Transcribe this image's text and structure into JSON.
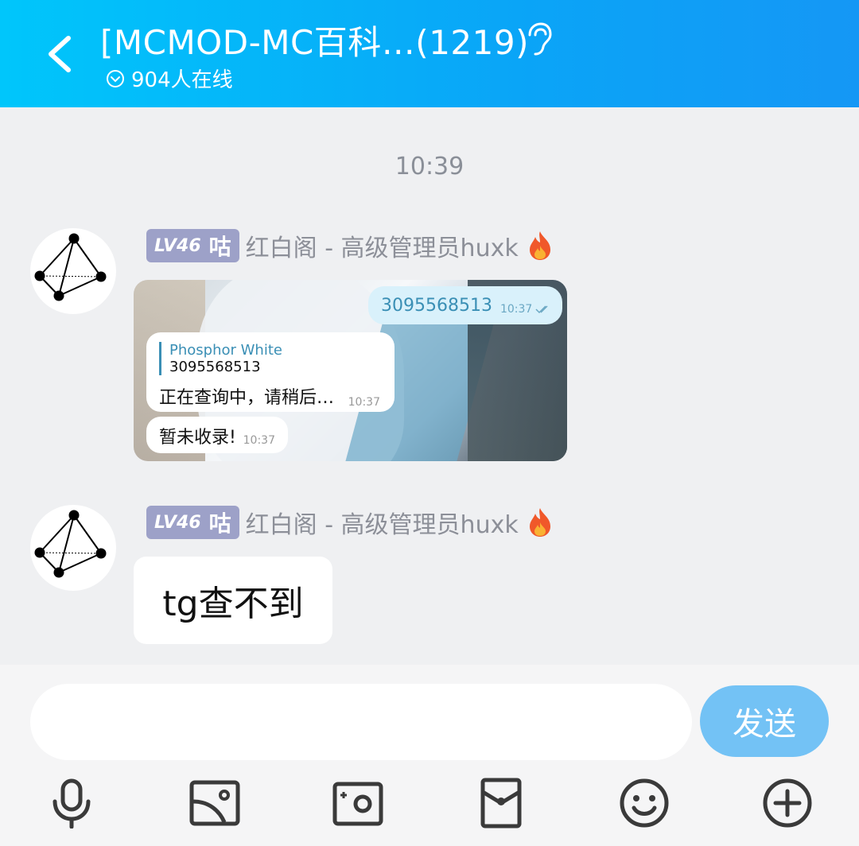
{
  "header": {
    "title": "[MCMOD-MC百科…(1219)",
    "online": "904人在线"
  },
  "chat": {
    "timestamp": "10:39",
    "messages": [
      {
        "level": "LV46",
        "level_title": "咕",
        "sender": "红白阁 - 高级管理员huxk",
        "type": "image",
        "screenshot": {
          "outgoing_text": "3095568513",
          "outgoing_time": "10:37",
          "reply_quote_name": "Phosphor White",
          "reply_quote_text": "3095568513",
          "reply_text": "正在查询中，请稍后…",
          "reply_time": "10:37",
          "reply2_text": "暂未收录!",
          "reply2_time": "10:37"
        }
      },
      {
        "level": "LV46",
        "level_title": "咕",
        "sender": "红白阁 - 高级管理员huxk",
        "type": "text",
        "text": "tg查不到"
      }
    ]
  },
  "input": {
    "value": "",
    "placeholder": "",
    "send_label": "发送"
  },
  "toolbar": {
    "icons": [
      "microphone-icon",
      "image-icon",
      "camera-icon",
      "red-packet-icon",
      "emoji-icon",
      "plus-icon"
    ]
  },
  "colors": {
    "header_start": "#00c6fb",
    "header_end": "#1597f5",
    "send_button": "#73c2f5",
    "level_badge": "#9da1c8"
  }
}
